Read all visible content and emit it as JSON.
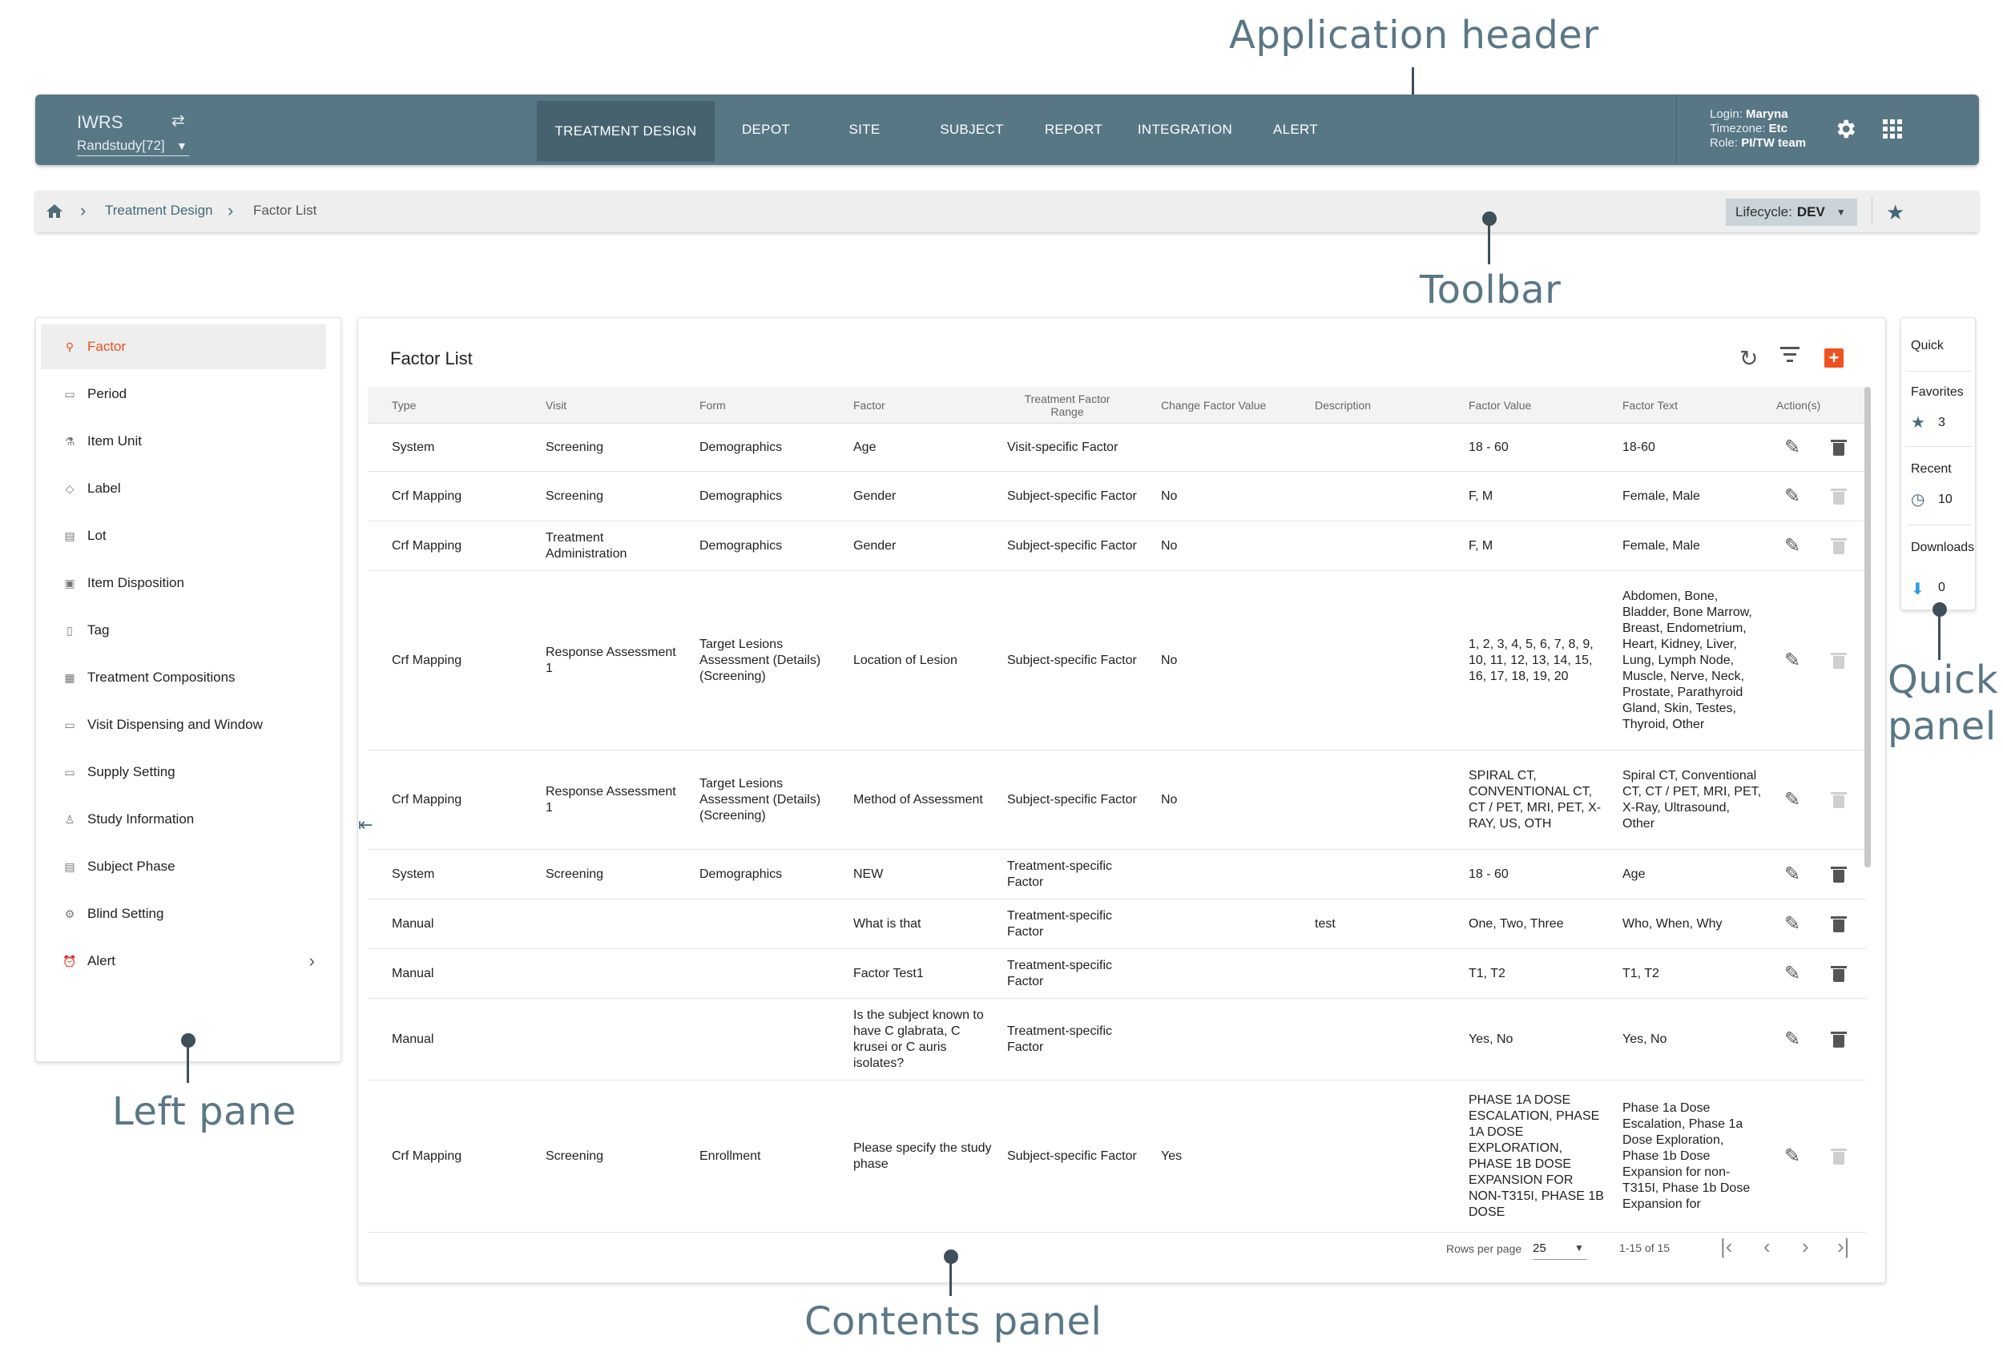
{
  "callouts": {
    "application_header": "Application header",
    "toolbar": "Toolbar",
    "left_pane": "Left pane",
    "contents_panel": "Contents panel",
    "quick_panel_line1": "Quick",
    "quick_panel_line2": "panel"
  },
  "header": {
    "brand": "IWRS",
    "study": "Randstudy[72]",
    "nav": [
      {
        "label": "TREATMENT DESIGN",
        "active": true
      },
      {
        "label": "DEPOT"
      },
      {
        "label": "SITE"
      },
      {
        "label": "SUBJECT"
      },
      {
        "label": "REPORT"
      },
      {
        "label": "INTEGRATION"
      },
      {
        "label": "ALERT"
      }
    ],
    "user": {
      "login_label": "Login:",
      "login": "Maryna",
      "timezone_label": "Timezone:",
      "timezone": "Etc",
      "role_label": "Role:",
      "role": "PI/TW team"
    },
    "icons": [
      "swap-icon",
      "settings-icon",
      "apps-grid-icon"
    ]
  },
  "toolbar": {
    "breadcrumb": [
      "Treatment Design",
      "Factor List"
    ],
    "lifecycle_label": "Lifecycle:",
    "lifecycle_value": "DEV",
    "icons": [
      "home-icon",
      "chevron-right-icon",
      "star-icon"
    ]
  },
  "left_pane": {
    "items": [
      {
        "label": "Factor",
        "active": true,
        "icon": "factor-icon"
      },
      {
        "label": "Period",
        "icon": "period-icon"
      },
      {
        "label": "Item Unit",
        "icon": "item-unit-icon"
      },
      {
        "label": "Label",
        "icon": "label-icon"
      },
      {
        "label": "Lot",
        "icon": "lot-icon"
      },
      {
        "label": "Item Disposition",
        "icon": "item-disposition-icon"
      },
      {
        "label": "Tag",
        "icon": "tag-icon"
      },
      {
        "label": "Treatment Compositions",
        "icon": "treatment-compositions-icon"
      },
      {
        "label": "Visit Dispensing and Window",
        "icon": "visit-dispensing-icon"
      },
      {
        "label": "Supply Setting",
        "icon": "supply-setting-icon"
      },
      {
        "label": "Study Information",
        "icon": "study-information-icon"
      },
      {
        "label": "Subject Phase",
        "icon": "subject-phase-icon"
      },
      {
        "label": "Blind Setting",
        "icon": "blind-setting-icon"
      },
      {
        "label": "Alert",
        "icon": "alert-icon",
        "expandable": true
      }
    ]
  },
  "contents": {
    "title": "Factor List",
    "columns": [
      "Type",
      "Visit",
      "Form",
      "Factor",
      "Treatment Factor Range",
      "Change Factor Value",
      "Description",
      "Factor Value",
      "Factor Text",
      "Action(s)"
    ],
    "rows": [
      {
        "type": "System",
        "visit": "Screening",
        "form": "Demographics",
        "factor": "Age",
        "range": "Visit-specific Factor",
        "change": "",
        "description": "",
        "value": "18 - 60",
        "text": "18-60",
        "delete_enabled": true
      },
      {
        "type": "Crf Mapping",
        "visit": "Screening",
        "form": "Demographics",
        "factor": "Gender",
        "range": "Subject-specific Factor",
        "change": "No",
        "description": "",
        "value": "F, M",
        "text": "Female, Male",
        "delete_enabled": false
      },
      {
        "type": "Crf Mapping",
        "visit": "Treatment Administration",
        "form": "Demographics",
        "factor": "Gender",
        "range": "Subject-specific Factor",
        "change": "No",
        "description": "",
        "value": "F, M",
        "text": "Female, Male",
        "delete_enabled": false
      },
      {
        "type": "Crf Mapping",
        "visit": "Response Assessment 1",
        "form": "Target Lesions Assessment (Details) (Screening)",
        "factor": "Location of Lesion",
        "range": "Subject-specific Factor",
        "change": "No",
        "description": "",
        "value": "1, 2, 3, 4, 5, 6, 7, 8, 9, 10, 11, 12, 13, 14, 15, 16, 17, 18, 19, 20",
        "text": "Abdomen, Bone, Bladder, Bone Marrow, Breast, Endometrium, Heart, Kidney, Liver, Lung, Lymph Node, Muscle, Nerve, Neck, Prostate, Parathyroid Gland, Skin, Testes, Thyroid, Other",
        "delete_enabled": false
      },
      {
        "type": "Crf Mapping",
        "visit": "Response Assessment 1",
        "form": "Target Lesions Assessment (Details) (Screening)",
        "factor": "Method of Assessment",
        "range": "Subject-specific Factor",
        "change": "No",
        "description": "",
        "value": "SPIRAL CT, CONVENTIONAL CT, CT / PET, MRI, PET, X-RAY, US, OTH",
        "text": "Spiral CT, Conventional CT, CT / PET, MRI, PET, X-Ray, Ultrasound, Other",
        "delete_enabled": false
      },
      {
        "type": "System",
        "visit": "Screening",
        "form": "Demographics",
        "factor": "NEW",
        "range": "Treatment-specific Factor",
        "change": "",
        "description": "",
        "value": "18 - 60",
        "text": "Age",
        "delete_enabled": true
      },
      {
        "type": "Manual",
        "visit": "",
        "form": "",
        "factor": "What is that",
        "range": "Treatment-specific Factor",
        "change": "",
        "description": "test",
        "value": "One, Two, Three",
        "text": "Who, When, Why",
        "delete_enabled": true
      },
      {
        "type": "Manual",
        "visit": "",
        "form": "",
        "factor": "Factor Test1",
        "range": "Treatment-specific Factor",
        "change": "",
        "description": "",
        "value": "T1, T2",
        "text": "T1, T2",
        "delete_enabled": true
      },
      {
        "type": "Manual",
        "visit": "",
        "form": "",
        "factor": "Is the subject known to have C glabrata, C krusei or C auris isolates?",
        "range": "Treatment-specific Factor",
        "change": "",
        "description": "",
        "value": "Yes, No",
        "text": "Yes, No",
        "delete_enabled": true
      },
      {
        "type": "Crf Mapping",
        "visit": "Screening",
        "form": "Enrollment",
        "factor": "Please specify the study phase",
        "range": "Subject-specific Factor",
        "change": "Yes",
        "description": "",
        "value": "PHASE 1A DOSE ESCALATION, PHASE 1A DOSE EXPLORATION, PHASE 1B DOSE EXPANSION FOR NON-T315I, PHASE 1B DOSE",
        "text": "Phase 1a Dose Escalation, Phase 1a Dose Exploration, Phase 1b Dose Expansion for non-T315I, Phase 1b Dose Expansion for",
        "delete_enabled": false
      }
    ],
    "pager": {
      "rows_per_page_label": "Rows per page",
      "rows_per_page": "25",
      "range": "1-15 of 15"
    },
    "icons": [
      "refresh-icon",
      "filter-icon",
      "add-icon",
      "edit-icon",
      "delete-icon",
      "collapse-pane-icon"
    ]
  },
  "quick_panel": {
    "title": "Quick",
    "favorites_label": "Favorites",
    "favorites_count": "3",
    "recent_label": "Recent",
    "recent_count": "10",
    "downloads_label": "Downloads",
    "downloads_count": "0"
  }
}
